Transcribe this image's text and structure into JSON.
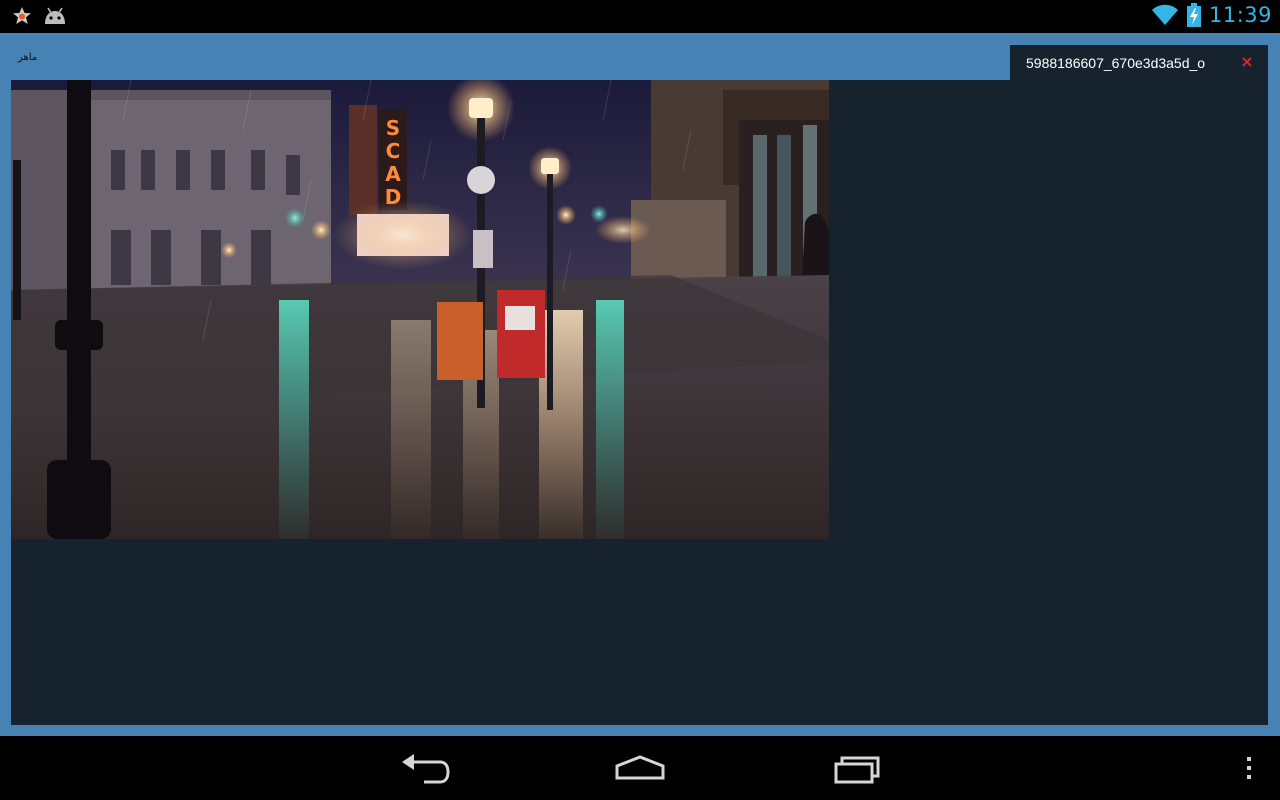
{
  "status_bar": {
    "time": "11:39",
    "notification_icons": [
      "star-icon",
      "android-icon"
    ],
    "system_icons": [
      "wifi-icon",
      "battery-charging-icon"
    ],
    "accent_color": "#33b5e5"
  },
  "app": {
    "icon": "app-logo-icon",
    "icon_text": "ماهر",
    "tab": {
      "label": "5988186607_670e3d3a5d_o",
      "close_glyph": "×"
    },
    "image": {
      "description_icon": "rainy-night-street-photo",
      "sign_letters": [
        "S",
        "C",
        "A",
        "D"
      ]
    },
    "colors": {
      "frame": "#4682b4",
      "panel": "#16232f",
      "close": "#e8251e"
    }
  },
  "nav_bar": {
    "buttons": [
      "back-icon",
      "home-icon",
      "recents-icon"
    ],
    "overflow": "more-vert-icon"
  }
}
